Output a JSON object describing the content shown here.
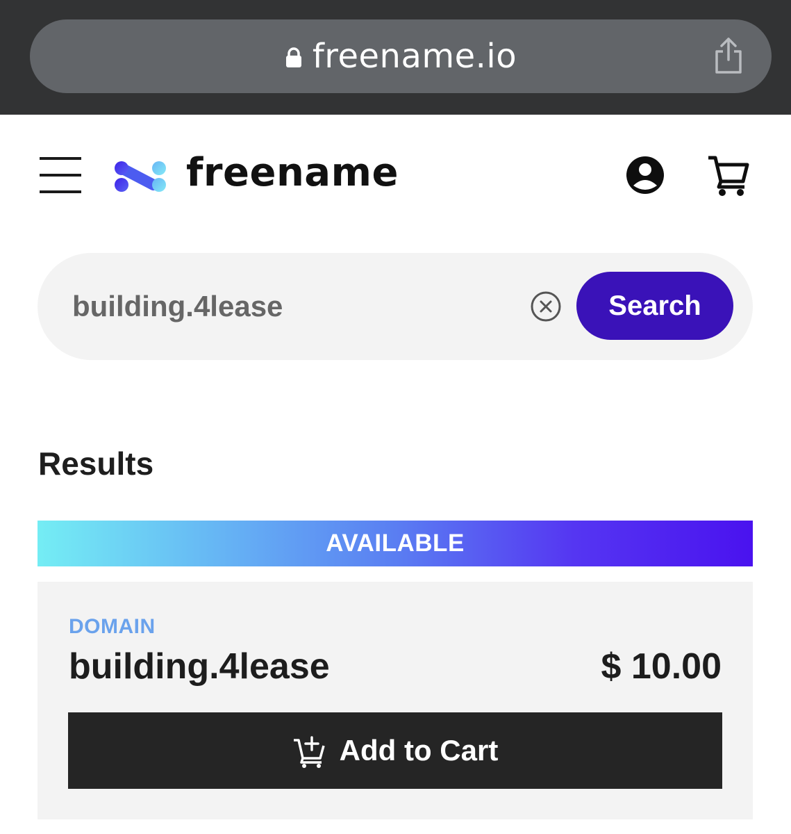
{
  "browser": {
    "url": "freename.io",
    "lock_icon": "lock-icon",
    "share_icon": "share-icon"
  },
  "header": {
    "logo_text": "freename",
    "menu_icon": "hamburger-menu-icon",
    "account_icon": "account-circle-icon",
    "cart_icon": "shopping-cart-icon"
  },
  "search": {
    "value": "building.4lease",
    "button_label": "Search",
    "clear_icon": "clear-circle-icon"
  },
  "results": {
    "heading": "Results",
    "status_banner": "AVAILABLE",
    "items": [
      {
        "type_label": "DOMAIN",
        "name": "building.4lease",
        "price": "$ 10.00",
        "button_label": "Add to Cart",
        "button_icon": "add-cart-icon"
      }
    ]
  },
  "colors": {
    "browser_chrome": "#323334",
    "url_pill": "#626569",
    "brand_purple": "#3a12b8",
    "domain_label": "#6aa2ec",
    "card_background": "#f3f3f3",
    "cart_button": "#252525",
    "banner_gradient_start": "#74edf4",
    "banner_gradient_end": "#4a12ef"
  }
}
